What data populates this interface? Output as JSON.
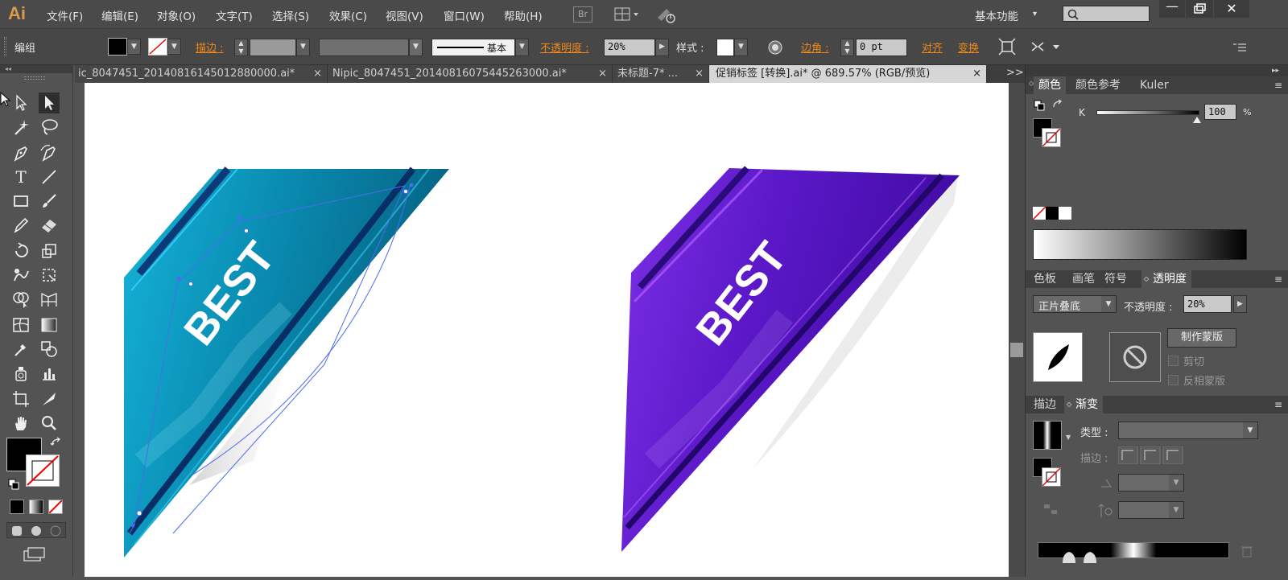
{
  "app": {
    "logo": "Ai",
    "menu": [
      "文件(F)",
      "编辑(E)",
      "对象(O)",
      "文字(T)",
      "选择(S)",
      "效果(C)",
      "视图(V)",
      "窗口(W)",
      "帮助(H)"
    ],
    "bridge_label": "Br",
    "workspace": "基本功能",
    "search_placeholder": ""
  },
  "control_bar": {
    "selection_label": "编组",
    "stroke_label": "描边 :",
    "stroke_style": "基本",
    "opacity_label": "不透明度 :",
    "opacity_value": "20%",
    "style_label": "样式 :",
    "corner_label": "边角 :",
    "corner_value": "0 pt",
    "align_label": "对齐",
    "transform_label": "变换"
  },
  "tabs": [
    {
      "label": "ic_8047451_20140816145012880000.ai*",
      "close": "×"
    },
    {
      "label": "Nipic_8047451_20140816075445263000.ai*",
      "close": "×"
    },
    {
      "label": "未标题-7* ...",
      "close": "×"
    },
    {
      "label": "促销标签 [转换].ai* @ 689.57% (RGB/预览)",
      "close": "×",
      "active": true
    }
  ],
  "tab_overflow": ">>",
  "artwork": {
    "left_banner_text": "BEST",
    "right_banner_text": "BEST"
  },
  "color_panel": {
    "tabs": [
      "颜色",
      "颜色参考",
      "Kuler"
    ],
    "channel_label": "K",
    "channel_value": "100",
    "percent": "%"
  },
  "transparency_panel": {
    "tabs": [
      "色板",
      "画笔",
      "符号",
      "透明度"
    ],
    "blend_mode": "正片叠底",
    "opacity_label": "不透明度 :",
    "opacity_value": "20%",
    "make_mask_button": "制作蒙版",
    "clip_label": "剪切",
    "invert_label": "反相蒙版"
  },
  "gradient_panel": {
    "tabs": [
      "描边",
      "渐变"
    ],
    "type_label": "类型 :",
    "stroke_label": "描边 :"
  },
  "colors": {
    "accent_orange": "#f0891a",
    "teal_banner": "#0a86a8",
    "purple_banner": "#5a15c0"
  }
}
